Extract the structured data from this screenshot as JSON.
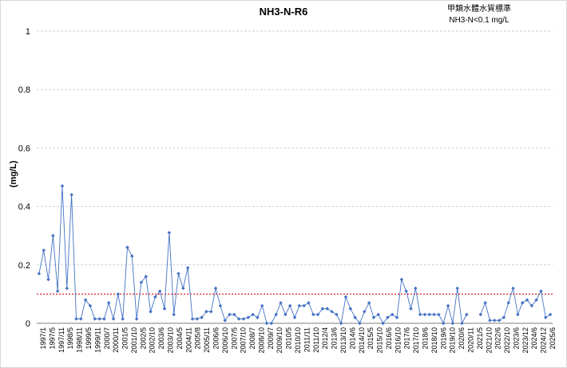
{
  "chart_data": {
    "type": "line",
    "title": "NH3-N-R6",
    "xlabel": "",
    "ylabel": "(mg/L)",
    "legend": {
      "title": "甲類水體水質標準",
      "threshold_label": "NH3-N<0.1 mg/L",
      "placement": "top-right"
    },
    "ylim": [
      0,
      1
    ],
    "yticks": [
      0,
      0.2,
      0.4,
      0.6,
      0.8,
      1
    ],
    "ytick_labels": [
      "0",
      "0.2",
      "0.4",
      "0.6",
      "0.8",
      "1"
    ],
    "grid": "horizontal dashed",
    "threshold": 0.1,
    "threshold_color": "#e03030",
    "series_color": "#4472c4",
    "tick_labels": [
      "1997/1",
      "1997/5",
      "1997/11",
      "1998/5",
      "1998/11",
      "1999/5",
      "1999/11",
      "2000/7",
      "2000/11",
      "2001/5",
      "2001/10",
      "2002/5",
      "2002/10",
      "2003/6",
      "2003/10",
      "2004/5",
      "2004/11",
      "2005/8",
      "2005/11",
      "2006/6",
      "2006/10",
      "2007/5",
      "2007/10",
      "2008/7",
      "2008/10",
      "2009/7",
      "2009/10",
      "2010/5",
      "2010/10",
      "2011/11",
      "2011/10",
      "2012/4",
      "2013/6",
      "2013/10",
      "2014/6",
      "2014/10",
      "2015/5",
      "2015/10",
      "2016/6",
      "2016/10",
      "2017/6",
      "2017/10",
      "2018/6",
      "2018/10",
      "2019/6",
      "2019/10",
      "2020/6",
      "2020/11",
      "2021/5",
      "2021/10",
      "2022/6",
      "2022/10",
      "2023/6",
      "2023/12",
      "2024/6",
      "2024/12",
      "2025/6"
    ],
    "series": [
      {
        "values": [
          0.17,
          0.25,
          0.15,
          0.3,
          0.11,
          0.47,
          0.12,
          0.44,
          0.015,
          0.015,
          0.08,
          0.06,
          0.015,
          0.015,
          0.015,
          0.07,
          0.015,
          0.1,
          0.015,
          0.26,
          0.23,
          0.015,
          0.14,
          0.16,
          0.04,
          0.09,
          0.11,
          0.05,
          0.31,
          0.03,
          0.17,
          0.12,
          0.19,
          0.015,
          0.015,
          0.02,
          0.04,
          0.04,
          0.12,
          0.06,
          0.01,
          0.03,
          0.03,
          0.015,
          0.015,
          0.02,
          0.03,
          0.02,
          0.06,
          0.0,
          0.0,
          0.03,
          0.07,
          0.03,
          0.06,
          0.02,
          0.06,
          0.06,
          0.07,
          0.03,
          0.03,
          0.05,
          0.05,
          0.04,
          0.03,
          0.0,
          0.09,
          0.05,
          0.02,
          0.0,
          0.04,
          0.07,
          0.02,
          0.03,
          0.0,
          0.02,
          0.03,
          0.02,
          0.15,
          0.11,
          0.05,
          0.12,
          0.03,
          0.03,
          0.03,
          0.03,
          0.03,
          0.0,
          0.06,
          0.0,
          0.12,
          0.0,
          0.03,
          null,
          null,
          0.03,
          0.07,
          0.01,
          0.01,
          0.01,
          0.02,
          0.07,
          0.12,
          0.03,
          0.07,
          0.08,
          0.06,
          0.08,
          0.11,
          0.02,
          0.03
        ]
      }
    ]
  }
}
